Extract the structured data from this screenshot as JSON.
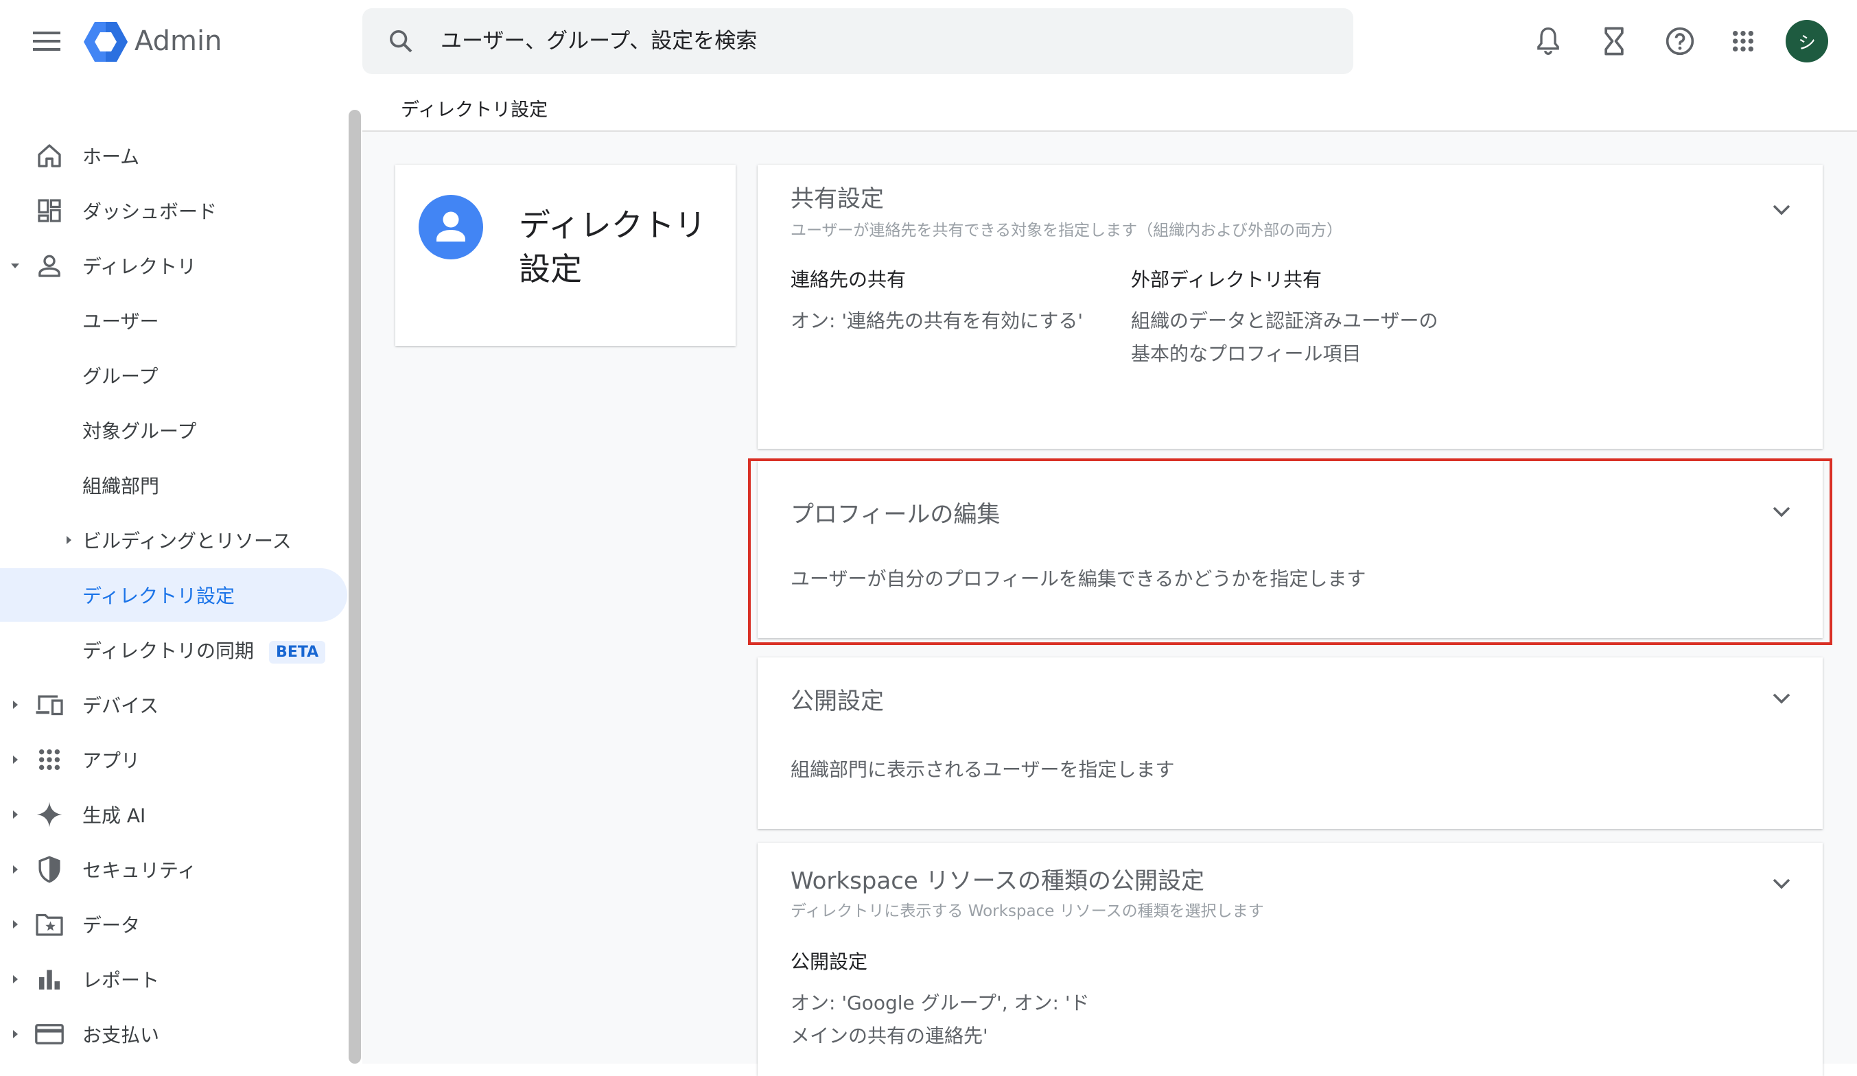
{
  "header": {
    "app_name": "Admin",
    "search_placeholder": "ユーザー、グループ、設定を検索",
    "avatar_initial": "シ"
  },
  "sidebar": {
    "items": [
      {
        "label": "ホーム",
        "icon": "home-icon"
      },
      {
        "label": "ダッシュボード",
        "icon": "dashboard-icon"
      },
      {
        "label": "ディレクトリ",
        "icon": "person-icon"
      },
      {
        "label": "ユーザー"
      },
      {
        "label": "グループ"
      },
      {
        "label": "対象グループ"
      },
      {
        "label": "組織部門"
      },
      {
        "label": "ビルディングとリソース"
      },
      {
        "label": "ディレクトリ設定"
      },
      {
        "label": "ディレクトリの同期",
        "badge": "BETA"
      },
      {
        "label": "デバイス",
        "icon": "devices-icon"
      },
      {
        "label": "アプリ",
        "icon": "apps-icon"
      },
      {
        "label": "生成 AI",
        "icon": "sparkle-icon"
      },
      {
        "label": "セキュリティ",
        "icon": "shield-icon"
      },
      {
        "label": "データ",
        "icon": "folder-star-icon"
      },
      {
        "label": "レポート",
        "icon": "bar-chart-icon"
      },
      {
        "label": "お支払い",
        "icon": "credit-card-icon"
      }
    ]
  },
  "main": {
    "breadcrumb": "ディレクトリ設定",
    "page_card_title": "ディレクトリ設定",
    "cards": {
      "sharing": {
        "title": "共有設定",
        "subtitle": "ユーザーが連絡先を共有できる対象を指定します（組織内および外部の両方）",
        "settings": [
          {
            "label": "連絡先の共有",
            "value": "オン: '連絡先の共有を有効にする'"
          },
          {
            "label": "外部ディレクトリ共有",
            "value": "組織のデータと認証済みユーザーの基本的なプロフィール項目"
          }
        ]
      },
      "profile": {
        "title": "プロフィールの編集",
        "description": "ユーザーが自分のプロフィールを編集できるかどうかを指定します"
      },
      "visibility": {
        "title": "公開設定",
        "description": "組織部門に表示されるユーザーを指定します"
      },
      "workspace": {
        "title": "Workspace リソースの種類の公開設定",
        "subtitle": "ディレクトリに表示する Workspace リソースの種類を選択します",
        "setting_label": "公開設定",
        "setting_value": "オン: 'Google グループ', オン: 'ドメインの共有の連絡先'"
      }
    }
  },
  "colors": {
    "accent": "#1a73e8",
    "highlight_border": "#d93025",
    "avatar_bg": "#1e5b40"
  }
}
